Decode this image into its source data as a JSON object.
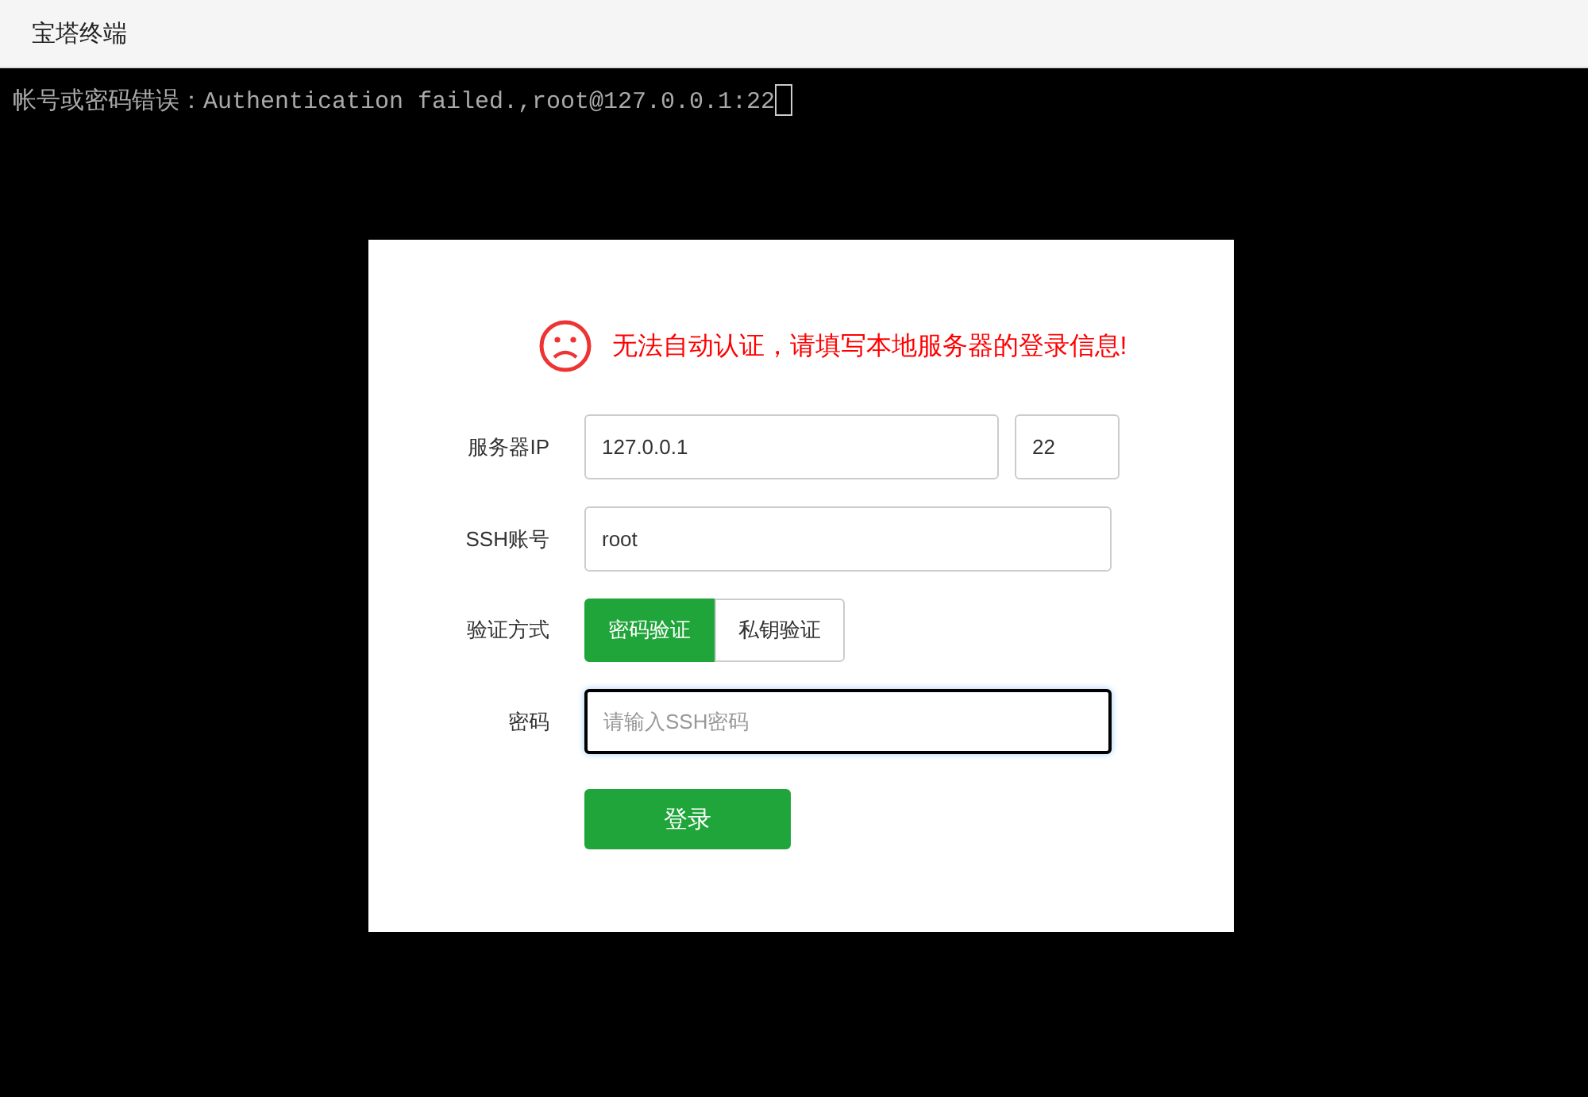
{
  "window": {
    "title": "宝塔终端"
  },
  "terminal": {
    "lines": [
      "帐号或密码错误：Authentication failed.,root@127.0.0.1:22"
    ],
    "cursor": true
  },
  "dialog": {
    "message": "无法自动认证，请填写本地服务器的登录信息!",
    "fields": [
      {
        "kind": "host",
        "label": "服务器IP",
        "value": "127.0.0.1",
        "port": "22"
      },
      {
        "kind": "text",
        "label": "SSH账号",
        "value": "root"
      },
      {
        "kind": "choice",
        "label": "验证方式",
        "options": [
          {
            "label": "密码验证",
            "selected": true
          },
          {
            "label": "私钥验证",
            "selected": false
          }
        ]
      },
      {
        "kind": "password",
        "label": "密码",
        "placeholder": "请输入SSH密码",
        "focused": true
      }
    ],
    "submit": "登录"
  }
}
